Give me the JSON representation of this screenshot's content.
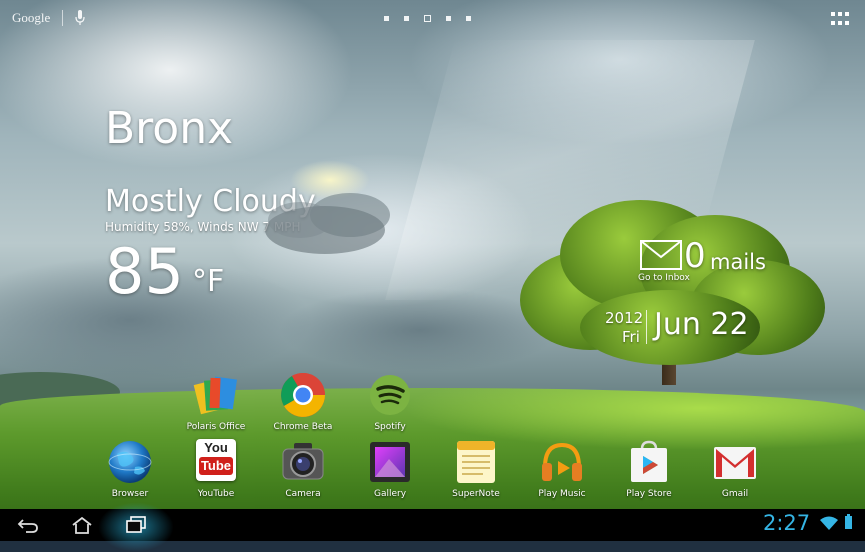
{
  "search_bar": {
    "logo_text": "Google",
    "mic_icon": "microphone-icon"
  },
  "page_indicators": {
    "count": 5,
    "current": 3
  },
  "apps_button_icon": "apps-grid-icon",
  "weather": {
    "city": "Bronx",
    "condition": "Mostly Cloudy",
    "details": "Humidity 58%, Winds NW 7 MPH",
    "temperature": "85",
    "unit": "°F",
    "icon": "cloud-sun-icon"
  },
  "mail_widget": {
    "count": "0",
    "label": "mails",
    "link": "Go to Inbox",
    "icon": "envelope-icon"
  },
  "date_widget": {
    "year": "2012",
    "weekday": "Fri",
    "date": "Jun 22"
  },
  "shortcuts": [
    {
      "label": "Polaris Office",
      "icon": "polaris-office-icon"
    },
    {
      "label": "Chrome Beta",
      "icon": "chrome-icon"
    },
    {
      "label": "Spotify",
      "icon": "spotify-icon"
    }
  ],
  "dock": [
    {
      "label": "Browser",
      "icon": "browser-globe-icon"
    },
    {
      "label": "YouTube",
      "icon": "youtube-icon",
      "icon_text_top": "You",
      "icon_text_bottom": "Tube"
    },
    {
      "label": "Camera",
      "icon": "camera-icon"
    },
    {
      "label": "Gallery",
      "icon": "gallery-icon"
    },
    {
      "label": "SuperNote",
      "icon": "supernote-icon"
    },
    {
      "label": "Play Music",
      "icon": "headphones-icon"
    },
    {
      "label": "Play Store",
      "icon": "play-store-icon"
    },
    {
      "label": "Gmail",
      "icon": "gmail-icon"
    }
  ],
  "navbar": {
    "back_icon": "back-icon",
    "home_icon": "home-icon",
    "recents_icon": "recent-apps-icon",
    "clock": "2:27",
    "wifi_icon": "wifi-icon",
    "battery_icon": "battery-icon"
  },
  "colors": {
    "accent_blue": "#35b5e5",
    "navbar_bg": "#000000"
  }
}
